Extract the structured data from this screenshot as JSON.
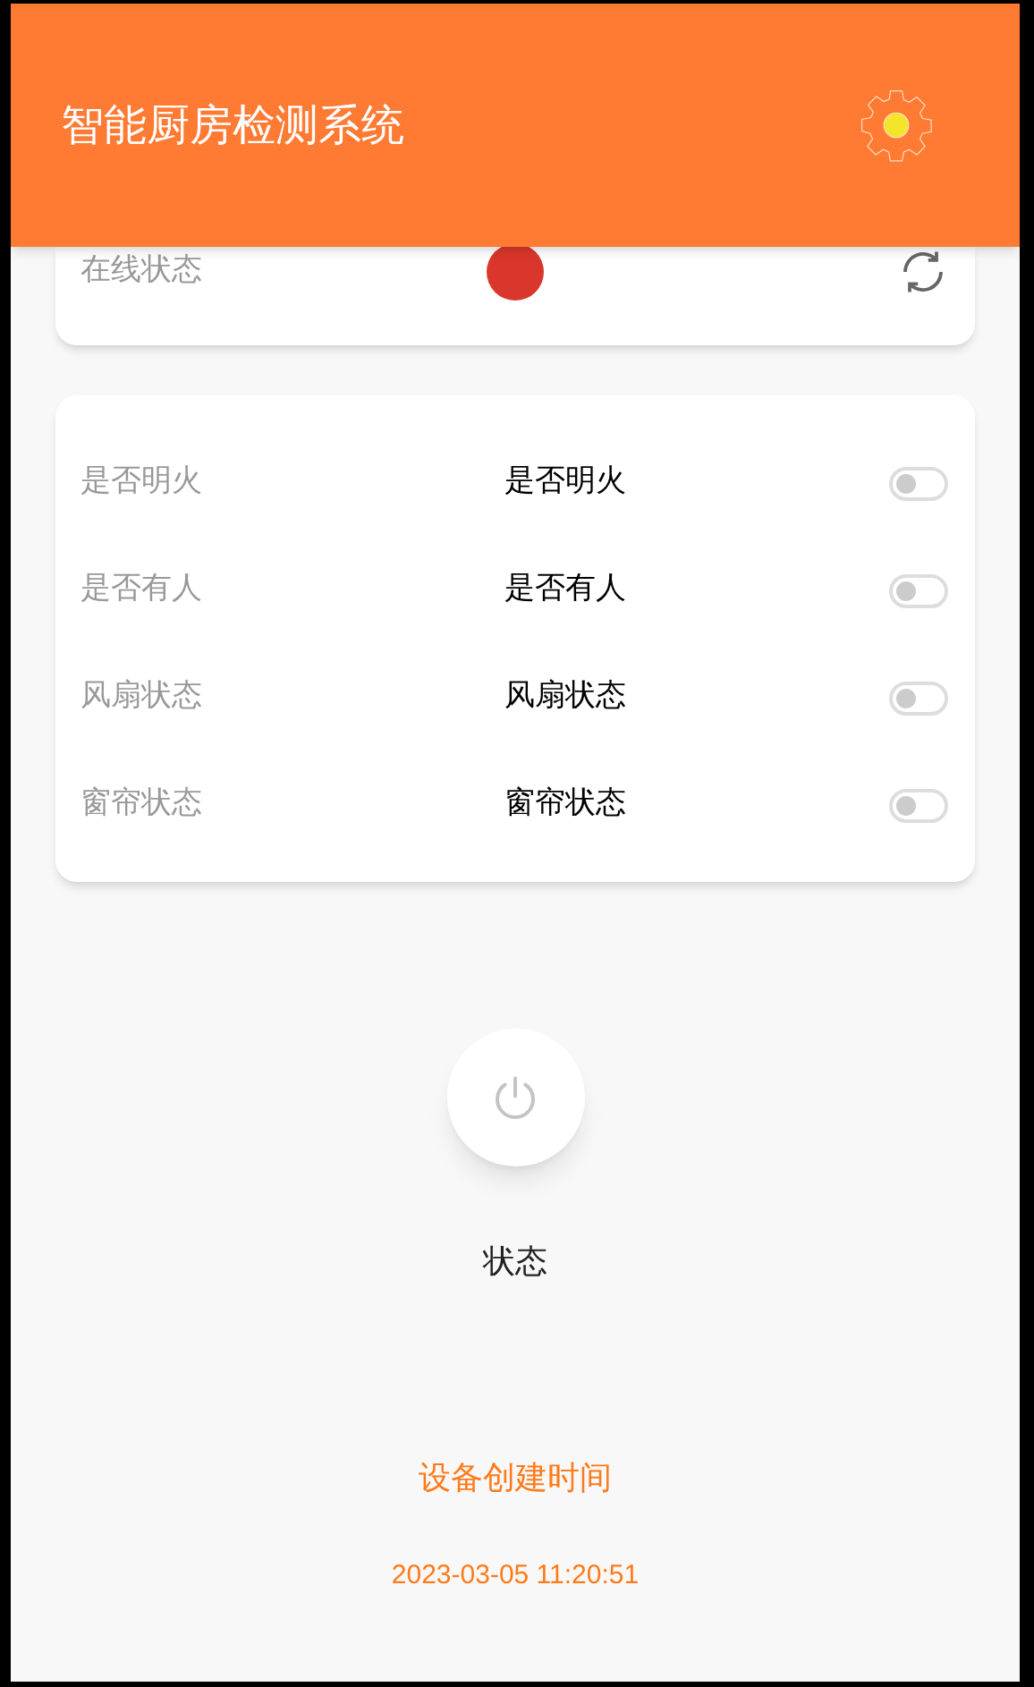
{
  "app_bar": {
    "title": "智能厨房检测系统"
  },
  "online_card": {
    "label": "在线状态",
    "online": false
  },
  "sensors": [
    {
      "label": "是否明火",
      "value": "是否明火",
      "on": false
    },
    {
      "label": "是否有人",
      "value": "是否有人",
      "on": false
    },
    {
      "label": "风扇状态",
      "value": "风扇状态",
      "on": false
    },
    {
      "label": "窗帘状态",
      "value": "窗帘状态",
      "on": false
    }
  ],
  "power": {
    "on": false,
    "label": "状态"
  },
  "created": {
    "label": "设备创建时间",
    "time": "2023-03-05 11:20:51"
  }
}
